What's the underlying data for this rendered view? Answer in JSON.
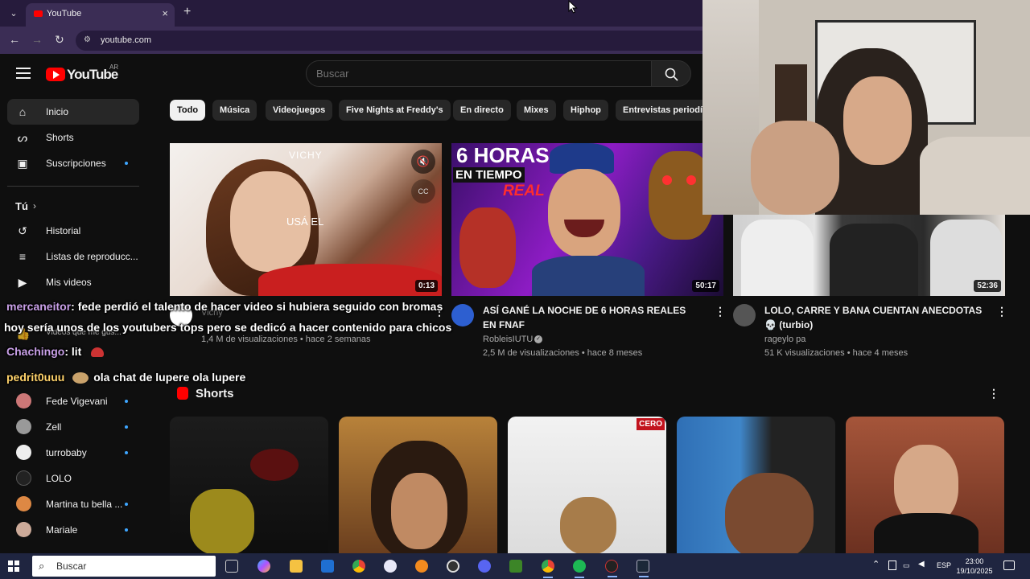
{
  "browser": {
    "tab_title": "YouTube",
    "url": "youtube.com"
  },
  "header": {
    "logo_text": "YouTube",
    "country": "AR",
    "search_placeholder": "Buscar"
  },
  "sidebar": {
    "items": [
      {
        "label": "Inicio",
        "icon": "home-icon",
        "active": true
      },
      {
        "label": "Shorts",
        "icon": "shorts-icon"
      },
      {
        "label": "Suscripciones",
        "icon": "subscriptions-icon",
        "dot": true
      }
    ],
    "you_section": "Tú",
    "you_items": [
      {
        "label": "Historial",
        "icon": "history-icon"
      },
      {
        "label": "Listas de reproducc...",
        "icon": "playlists-icon"
      },
      {
        "label": "Mis videos",
        "icon": "my-videos-icon"
      },
      {
        "label": "Videos que me gus...",
        "icon": "liked-icon"
      }
    ],
    "subscriptions": [
      {
        "label": "Fede Vigevani",
        "dot": true,
        "color": "#c77"
      },
      {
        "label": "Zell",
        "dot": true,
        "color": "#999"
      },
      {
        "label": "turrobaby",
        "dot": true,
        "color": "#eee"
      },
      {
        "label": "LOLO",
        "dot": false,
        "color": "#222"
      },
      {
        "label": "Martina tu bella ...",
        "dot": true,
        "color": "#d84"
      },
      {
        "label": "Mariale",
        "dot": true,
        "color": "#ca9"
      }
    ]
  },
  "chips": [
    "Todo",
    "Música",
    "Videojuegos",
    "Five Nights at Freddy's",
    "En directo",
    "Mixes",
    "Hiphop",
    "Entrevistas periodís"
  ],
  "videos": [
    {
      "thumb_text_1": "VICHY",
      "thumb_text_2": "USÁ EL",
      "duration": "0:13",
      "channel": "Vichy",
      "meta": "1,4 M de visualizaciones • hace 2 semanas"
    },
    {
      "thumb_text_1": "6 HORAS",
      "thumb_text_2": "EN TIEMPO",
      "thumb_text_3": "REAL",
      "duration": "50:17",
      "title": "ASÍ GANÉ LA NOCHE DE 6 HORAS REALES EN FNAF",
      "channel": "RobleisIUTU",
      "meta": "2,5 M de visualizaciones • hace 8 meses"
    },
    {
      "duration": "52:36",
      "title": "LOLO, CARRE Y BANA CUENTAN ANECDOTAS 💀 (turbio)",
      "channel": "rageylo pa",
      "meta": "51 K visualizaciones • hace 4 meses"
    }
  ],
  "shorts": {
    "title": "Shorts",
    "badge": "CERO"
  },
  "chat": [
    {
      "user": "mercaneitor",
      "text": ": fede perdió el talento de hacer video si hubiera seguido con bromas"
    },
    {
      "user": "",
      "text": "hoy sería unos de los youtubers tops pero se dedicó a hacer contenido para chicos"
    },
    {
      "user": "Chachingo",
      "text": ": lit"
    },
    {
      "user": "pedrit0uuu",
      "text": "ola chat de lupere ola lupere"
    }
  ],
  "taskbar": {
    "search_text": "Buscar",
    "lang": "ESP",
    "time": "23:00",
    "date": "19/10/2025"
  }
}
